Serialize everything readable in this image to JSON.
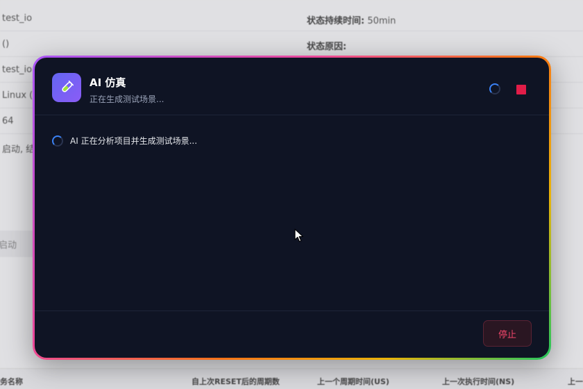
{
  "background": {
    "rows": [
      {
        "left": "test_io",
        "right_label": "状态持续时间:",
        "right_value": " 50min"
      },
      {
        "left": "()",
        "right_label": "状态原因:",
        "right_value": ""
      },
      {
        "left": "test_io (",
        "right_label": "",
        "right_value": ""
      },
      {
        "left": "Linux (",
        "right_label": "",
        "right_value": ""
      },
      {
        "left": "64",
        "right_label": "",
        "right_value": ""
      },
      {
        "left": " 启动, 结",
        "right_label": "",
        "right_value": ""
      }
    ],
    "button_label": "启动",
    "table_headers": [
      "务名称",
      "自上次RESET后的周期数",
      "上一个周期时间(US)",
      "上一次执行时间(NS)",
      "上一"
    ]
  },
  "modal": {
    "title": "AI 仿真",
    "subtitle": "正在生成测试场景...",
    "status_text": "AI 正在分析项目并生成测试场景...",
    "stop_label": "停止"
  },
  "colors": {
    "modal_bg": "#0f1424",
    "accent": "#6366f1",
    "stop": "#e11d48"
  }
}
